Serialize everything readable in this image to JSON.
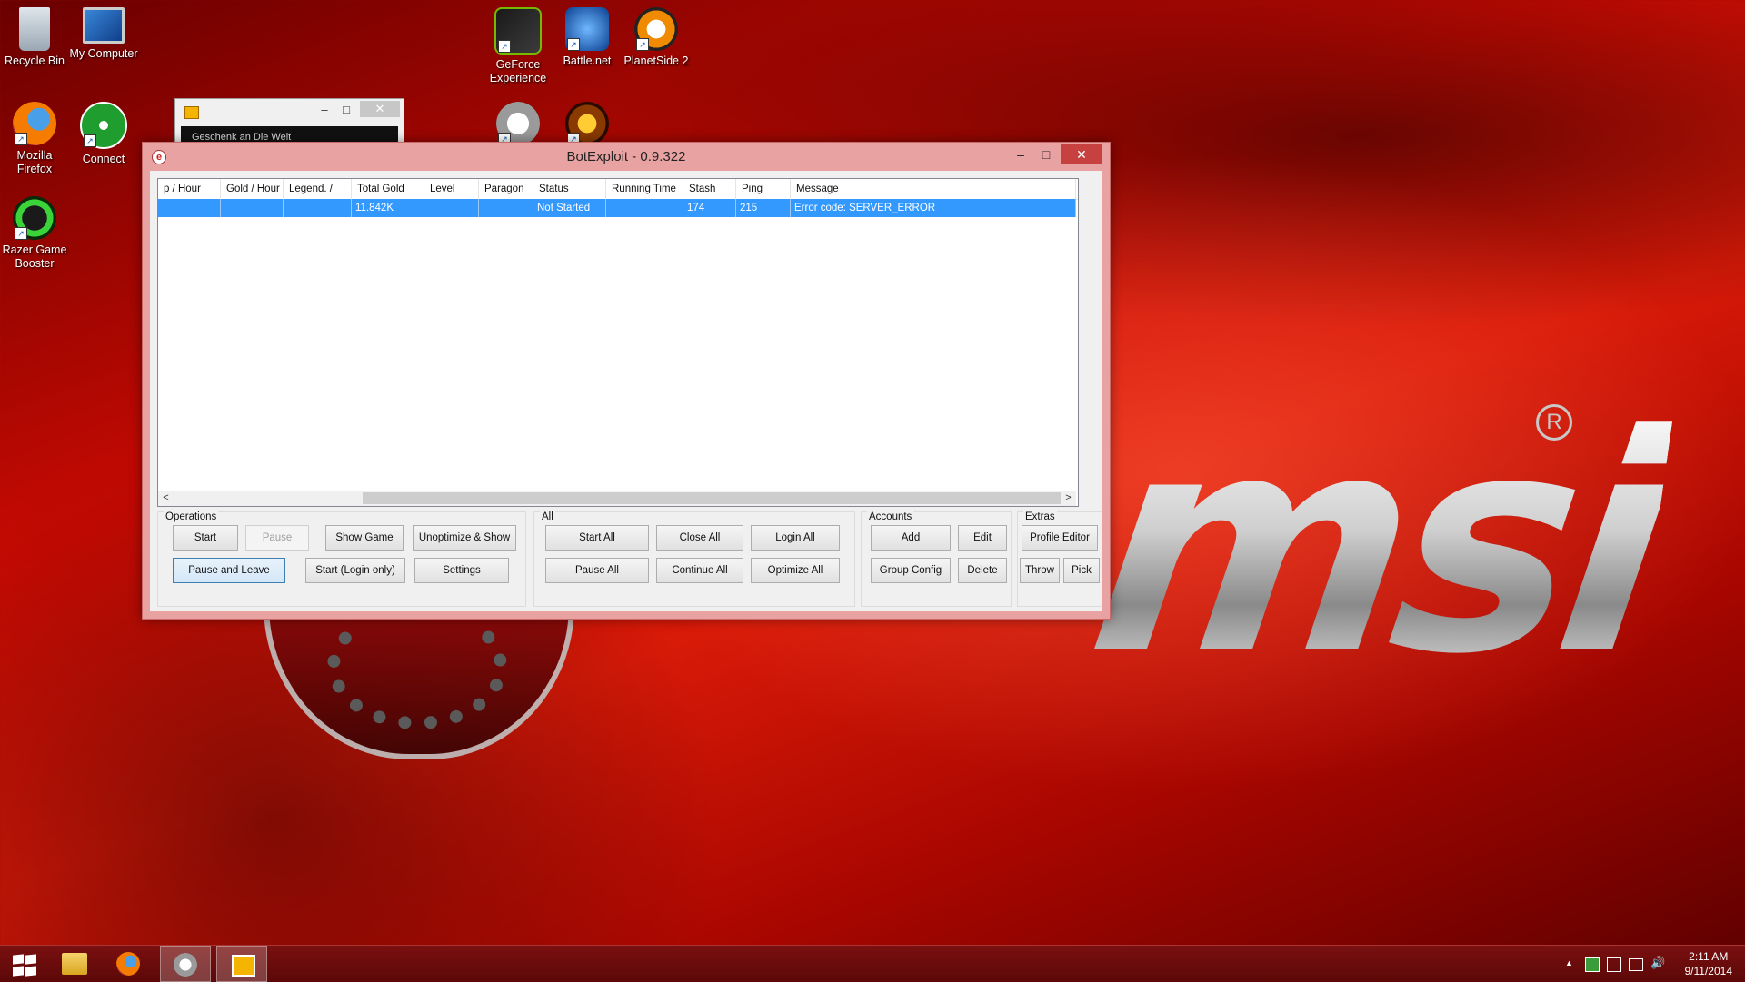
{
  "desktop": {
    "icons": [
      {
        "label": "Recycle Bin"
      },
      {
        "label": "My Computer"
      },
      {
        "label": "Mozilla Firefox"
      },
      {
        "label": "Connect"
      },
      {
        "label": "Razer Game Booster"
      },
      {
        "label": "GeForce Experience"
      },
      {
        "label": "Battle.net"
      },
      {
        "label": "PlanetSide 2"
      }
    ],
    "wallpaper_logo": "msi",
    "wallpaper_reg": "R"
  },
  "mini_window": {
    "track": "Geschenk an Die Welt",
    "minimize": "–",
    "maximize": "□",
    "close": "✕"
  },
  "window": {
    "title": "BotExploit - 0.9.322",
    "minimize": "–",
    "maximize": "□",
    "close": "✕",
    "app_icon": "e"
  },
  "list": {
    "columns": [
      "p / Hour",
      "Gold / Hour",
      "Legend. /",
      "Total Gold",
      "Level",
      "Paragon",
      "Status",
      "Running Time",
      "Stash",
      "Ping",
      "Message"
    ],
    "rows": [
      [
        "",
        "",
        "",
        "11.842K",
        "",
        "",
        "Not Started",
        "",
        "174",
        "215",
        "Error code: SERVER_ERROR"
      ]
    ],
    "scroll_left": "<",
    "scroll_right": ">"
  },
  "operations": {
    "label": "Operations",
    "start": "Start",
    "pause": "Pause",
    "show_game": "Show Game",
    "unoptimize_show": "Unoptimize & Show",
    "pause_leave": "Pause and Leave",
    "start_login": "Start (Login only)",
    "settings": "Settings"
  },
  "all": {
    "label": "All",
    "start_all": "Start All",
    "close_all": "Close All",
    "login_all": "Login All",
    "pause_all": "Pause All",
    "continue_all": "Continue All",
    "optimize_all": "Optimize All"
  },
  "accounts": {
    "label": "Accounts",
    "add": "Add",
    "edit": "Edit",
    "group_config": "Group Config",
    "delete": "Delete"
  },
  "extras": {
    "label": "Extras",
    "profile_editor": "Profile Editor",
    "throw": "Throw",
    "pick": "Pick"
  },
  "taskbar": {
    "clock_time": "2:11 AM",
    "clock_date": "9/11/2014",
    "tray_up": "▲",
    "volume": "🔊"
  },
  "colors": {
    "selection": "#3399ff",
    "close_button": "#c74141",
    "window_frame": "#e9a2a2"
  }
}
